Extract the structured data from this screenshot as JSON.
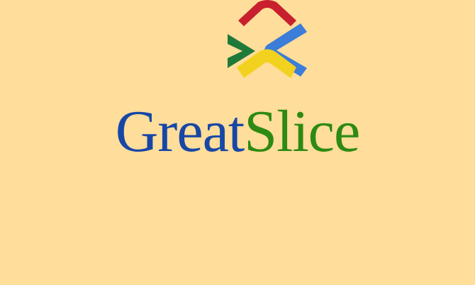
{
  "page": {
    "background_color": "#FFDD9A"
  },
  "logo": {
    "icon": "four-chevron-logo-icon",
    "colors": {
      "top": "#C8202E",
      "left": "#1F7A3A",
      "right": "#3B7DD8",
      "bottom": "#F2D21E"
    }
  },
  "brand": {
    "part_one": "Great",
    "part_two": "Slice",
    "part_one_color": "#1747A6",
    "part_two_color": "#2D8A12"
  }
}
